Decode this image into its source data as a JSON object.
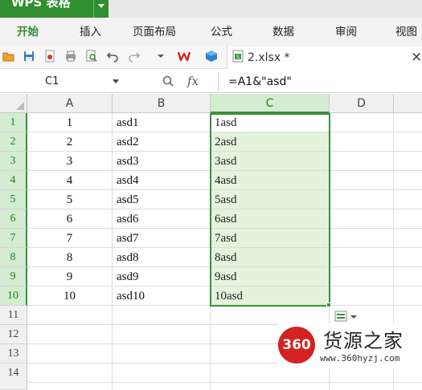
{
  "app": {
    "title": "WPS 表格"
  },
  "ribbon": {
    "tabs": [
      "开始",
      "插入",
      "页面布局",
      "公式",
      "数据",
      "审阅",
      "视图"
    ],
    "active": "开始"
  },
  "toolbar": {
    "file_tab": "2.xlsx *",
    "close_glyph": "×"
  },
  "formula_bar": {
    "name_box": "C1",
    "fx_label": "fx",
    "formula": "=A1&\"asd\""
  },
  "sheet": {
    "columns": [
      "A",
      "B",
      "C",
      "D"
    ],
    "selected_column": "C",
    "row_numbers": [
      "1",
      "2",
      "3",
      "4",
      "5",
      "6",
      "7",
      "8",
      "9",
      "10",
      "11",
      "12",
      "13",
      "14"
    ],
    "col_a": [
      "1",
      "2",
      "3",
      "4",
      "5",
      "6",
      "7",
      "8",
      "9",
      "10"
    ],
    "col_b": [
      "asd1",
      "asd2",
      "asd3",
      "asd4",
      "asd5",
      "asd6",
      "asd7",
      "asd8",
      "asd9",
      "asd10"
    ],
    "col_c": [
      "1asd",
      "2asd",
      "3asd",
      "4asd",
      "5asd",
      "6asd",
      "7asd",
      "8asd",
      "9asd",
      "10asd"
    ]
  },
  "watermark": {
    "logo": "360",
    "title": "货源之家",
    "url": "www.360hyzj.com"
  },
  "colors": {
    "brand_green": "#2f8f2f",
    "selection_green": "#3d8f3d",
    "fill_green": "#e3f3dc",
    "logo_red": "#d42121"
  }
}
